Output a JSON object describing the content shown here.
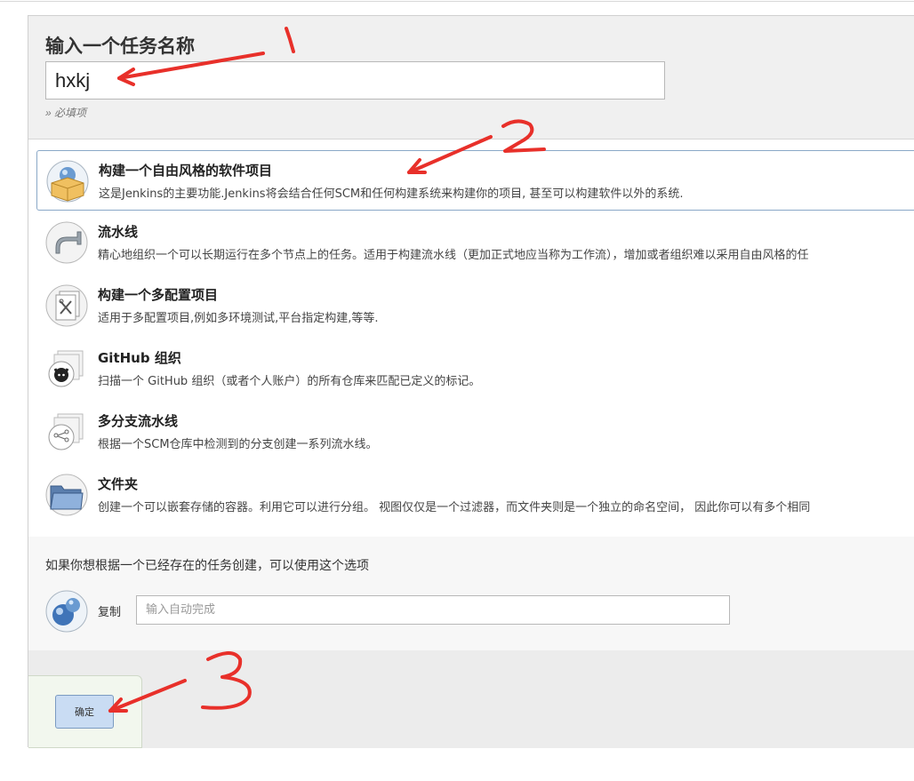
{
  "form": {
    "title": "输入一个任务名称",
    "item_name_value": "hxkj",
    "required_hint": "» 必填项"
  },
  "item_types": [
    {
      "name": "构建一个自由风格的软件项目",
      "description": "这是Jenkins的主要功能.Jenkins将会结合任何SCM和任何构建系统来构建你的项目, 甚至可以构建软件以外的系统.",
      "icon": "freestyle-box-icon",
      "selected": true
    },
    {
      "name": "流水线",
      "description": "精心地组织一个可以长期运行在多个节点上的任务。适用于构建流水线（更加正式地应当称为工作流），增加或者组织难以采用自由风格的任",
      "icon": "pipeline-icon",
      "selected": false
    },
    {
      "name": "构建一个多配置项目",
      "description": "适用于多配置项目,例如多环境测试,平台指定构建,等等.",
      "icon": "multi-config-icon",
      "selected": false
    },
    {
      "name": "GitHub 组织",
      "description": "扫描一个 GitHub 组织（或者个人账户）的所有仓库来匹配已定义的标记。",
      "icon": "github-org-icon",
      "selected": false
    },
    {
      "name": "多分支流水线",
      "description": "根据一个SCM仓库中检测到的分支创建一系列流水线。",
      "icon": "multibranch-icon",
      "selected": false
    },
    {
      "name": "文件夹",
      "description": "创建一个可以嵌套存储的容器。利用它可以进行分组。 视图仅仅是一个过滤器，而文件夹则是一个独立的命名空间， 因此你可以有多个相同",
      "icon": "folder-icon",
      "selected": false
    }
  ],
  "copy": {
    "text": "如果你想根据一个已经存在的任务创建，可以使用这个选项",
    "label": "复制",
    "placeholder": "输入自动完成"
  },
  "footer": {
    "ok_label": "确定"
  },
  "annotations": {
    "marks": [
      "1",
      "2",
      "3"
    ],
    "color": "#e8302a"
  }
}
